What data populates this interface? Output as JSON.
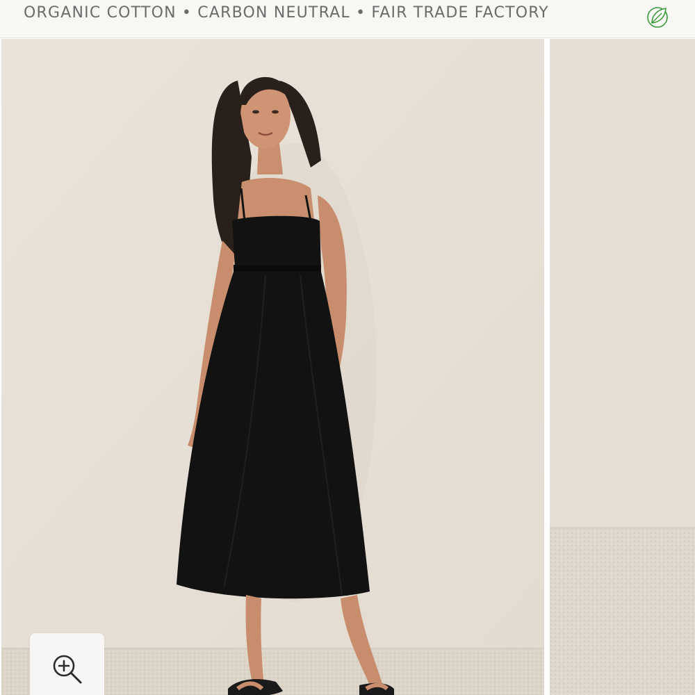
{
  "banner": {
    "text": "ORGANIC COTTON • CARBON NEUTRAL • FAIR TRADE FACTORY",
    "icon": "leaf-icon",
    "icon_color": "#3a9a3a",
    "text_color": "#6b6b6b",
    "background": "#f8f7f4"
  },
  "gallery": {
    "images": [
      {
        "name": "product-photo-model-black-dress",
        "alt": "Model wearing black strappy midi dress"
      },
      {
        "name": "product-photo-next",
        "alt": "Next product photo"
      }
    ],
    "zoom_icon": "zoom-in-icon"
  },
  "colors": {
    "wall": "#e7e0d7",
    "floor": "#ddd6cb",
    "dress": "#121212"
  }
}
